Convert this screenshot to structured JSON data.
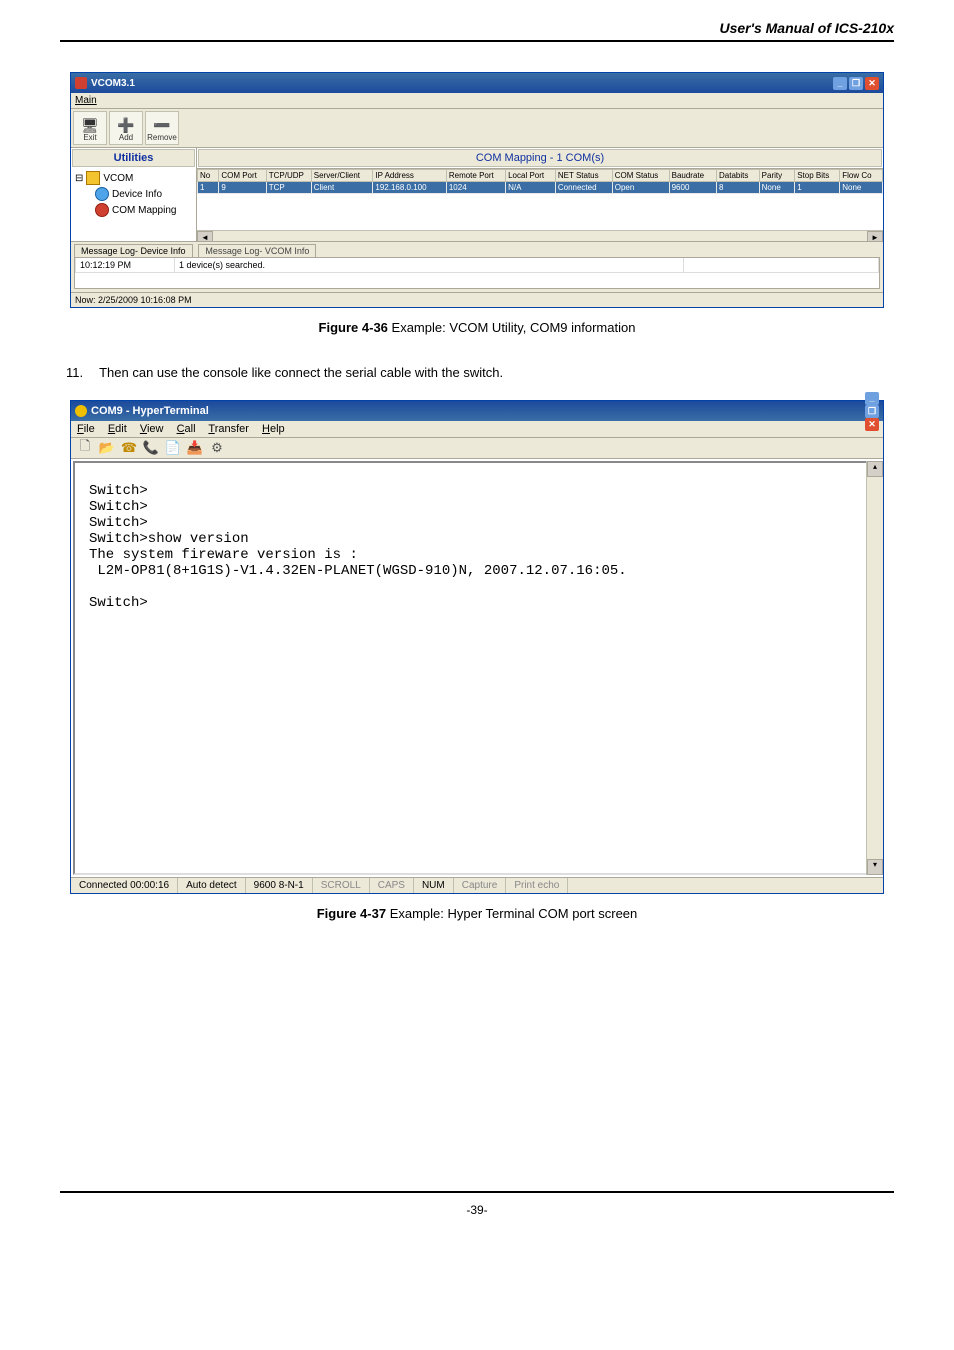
{
  "doc": {
    "header": "User's Manual of ICS-210x",
    "page": "-39-"
  },
  "vcom": {
    "title": "VCOM3.1",
    "menu": {
      "main": "Main"
    },
    "toolbar": {
      "exit": "Exit",
      "add": "Add",
      "remove": "Remove"
    },
    "left_header": "Utilities",
    "tree": {
      "root": "VCOM",
      "n1": "Device Info",
      "n2": "COM Mapping"
    },
    "right_header": "COM Mapping - 1 COM(s)",
    "columns": [
      "No",
      "COM Port",
      "TCP/UDP",
      "Server/Client",
      "IP Address",
      "Remote Port",
      "Local Port",
      "NET Status",
      "COM Status",
      "Baudrate",
      "Databits",
      "Parity",
      "Stop Bits",
      "Flow Co"
    ],
    "row": [
      "1",
      "9",
      "TCP",
      "Client",
      "192.168.0.100",
      "1024",
      "N/A",
      "Connected",
      "Open",
      "9600",
      "8",
      "None",
      "1",
      "None"
    ],
    "logtabs": {
      "a": "Message Log- Device Info",
      "b": "Message Log- VCOM Info"
    },
    "log": {
      "time": "10:12:19 PM",
      "msg": "1 device(s) searched."
    },
    "status": "Now: 2/25/2009 10:16:08 PM"
  },
  "fig1": {
    "bold": "Figure 4-36",
    "rest": " Example: VCOM Utility, COM9 information"
  },
  "step": {
    "num": "11.",
    "text": "Then can use the console like connect the serial cable with the switch."
  },
  "ht": {
    "title": "COM9 - HyperTerminal",
    "menus": {
      "file": "File",
      "edit": "Edit",
      "view": "View",
      "call": "Call",
      "transfer": "Transfer",
      "help": "Help"
    },
    "body": "Switch>\nSwitch>\nSwitch>\nSwitch>show version\nThe system fireware version is :\n L2M-OP81(8+1G1S)-V1.4.32EN-PLANET(WGSD-910)N, 2007.12.07.16:05.\n\nSwitch>",
    "status": {
      "conn": "Connected 00:00:16",
      "detect": "Auto detect",
      "params": "9600 8-N-1",
      "scroll": "SCROLL",
      "caps": "CAPS",
      "num": "NUM",
      "capture": "Capture",
      "echo": "Print echo"
    }
  },
  "fig2": {
    "bold": "Figure 4-37",
    "rest": " Example: Hyper Terminal COM port screen"
  }
}
